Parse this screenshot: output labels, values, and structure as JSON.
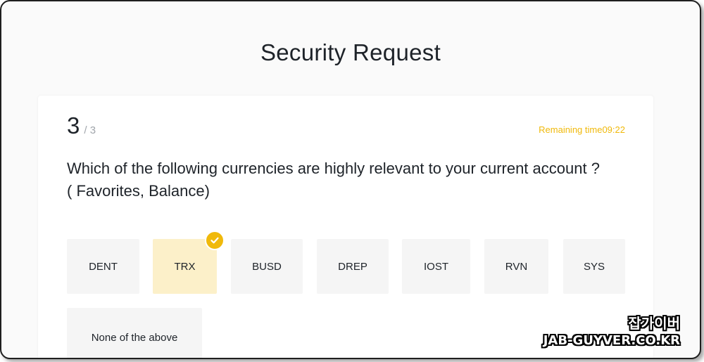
{
  "page": {
    "title": "Security Request"
  },
  "progress": {
    "current": "3",
    "total": "/ 3"
  },
  "timer": {
    "text": "Remaining time09:22"
  },
  "question": {
    "text": "Which of the following currencies are highly relevant to your current account ? ( Favorites, Balance)"
  },
  "options": [
    {
      "label": "DENT",
      "selected": false
    },
    {
      "label": "TRX",
      "selected": true
    },
    {
      "label": "BUSD",
      "selected": false
    },
    {
      "label": "DREP",
      "selected": false
    },
    {
      "label": "IOST",
      "selected": false
    },
    {
      "label": "RVN",
      "selected": false
    },
    {
      "label": "SYS",
      "selected": false
    },
    {
      "label": "None of the above",
      "selected": false
    }
  ],
  "watermark": {
    "korean": "잡가이버",
    "domain": "JAB-GUYVER.CO.KR"
  },
  "colors": {
    "accent": "#f0b90b",
    "selected_bg": "#fcf0c9",
    "option_bg": "#f5f5f5"
  },
  "icons": {
    "selected_marker": "check-circle-icon"
  }
}
